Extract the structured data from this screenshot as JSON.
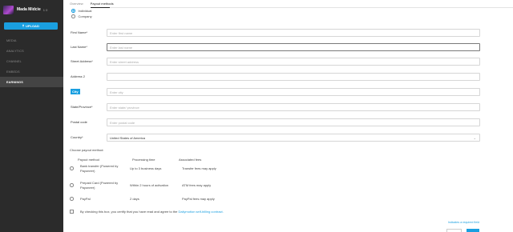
{
  "profile": {
    "name": "Mada Midcie",
    "count": "1 0"
  },
  "upload": {
    "label": "UPLOAD",
    "icon": "upload-icon"
  },
  "nav": [
    {
      "label": "MEDIA",
      "active": false
    },
    {
      "label": "ANALYTICS",
      "active": false
    },
    {
      "label": "CHANNEL",
      "active": false
    },
    {
      "label": "EMBEDS",
      "active": false
    },
    {
      "label": "EARNINGS",
      "active": true
    }
  ],
  "tabs": [
    {
      "label": "Overview",
      "active": false
    },
    {
      "label": "Payout methods",
      "active": true
    }
  ],
  "account_type": {
    "options": [
      {
        "label": "Individual",
        "checked": true
      },
      {
        "label": "Company",
        "checked": false
      }
    ]
  },
  "form": {
    "first_name": {
      "label": "First Name*",
      "placeholder": "Enter first name"
    },
    "last_name": {
      "label": "Last Name*",
      "placeholder": "Enter last name"
    },
    "street_address": {
      "label": "Street Address*",
      "placeholder": "Enter street address"
    },
    "address2": {
      "label": "Address 2",
      "placeholder": ""
    },
    "city": {
      "label": "City",
      "placeholder": "Enter city"
    },
    "state": {
      "label": "State/Province*",
      "placeholder": "Enter state/ province"
    },
    "postal": {
      "label": "Postal code",
      "placeholder": "Enter postal code"
    },
    "country": {
      "label": "Country*",
      "value": "United States of America"
    }
  },
  "payout": {
    "title": "Choose payout method:",
    "headers": {
      "method": "Payout method",
      "time": "Processing time",
      "fees": "Associated fees"
    },
    "methods": [
      {
        "name_line1": "Bank transfer (Powered by",
        "name_line2": "Payoneer)",
        "time": "Up to 3 business days",
        "fees": "Transfer fees may apply"
      },
      {
        "name_line1": "Prepaid Card (Powered by",
        "name_line2": "Payoneer)",
        "time": "Within 2 hours of activation",
        "fees": "ATM fees may apply"
      },
      {
        "name_line1": "PayPal",
        "name_line2": "",
        "time": "2 days",
        "fees": "PayPal fees may apply"
      }
    ]
  },
  "terms": {
    "text": "By checking this box, you certify that you have read and agree to the",
    "link": "Dailymotion self-billing contract."
  },
  "required_note": "Indicates a required field",
  "colors": {
    "accent": "#1a9fe0",
    "sidebar": "#2b2b2b",
    "sidebar_active": "#444444"
  }
}
